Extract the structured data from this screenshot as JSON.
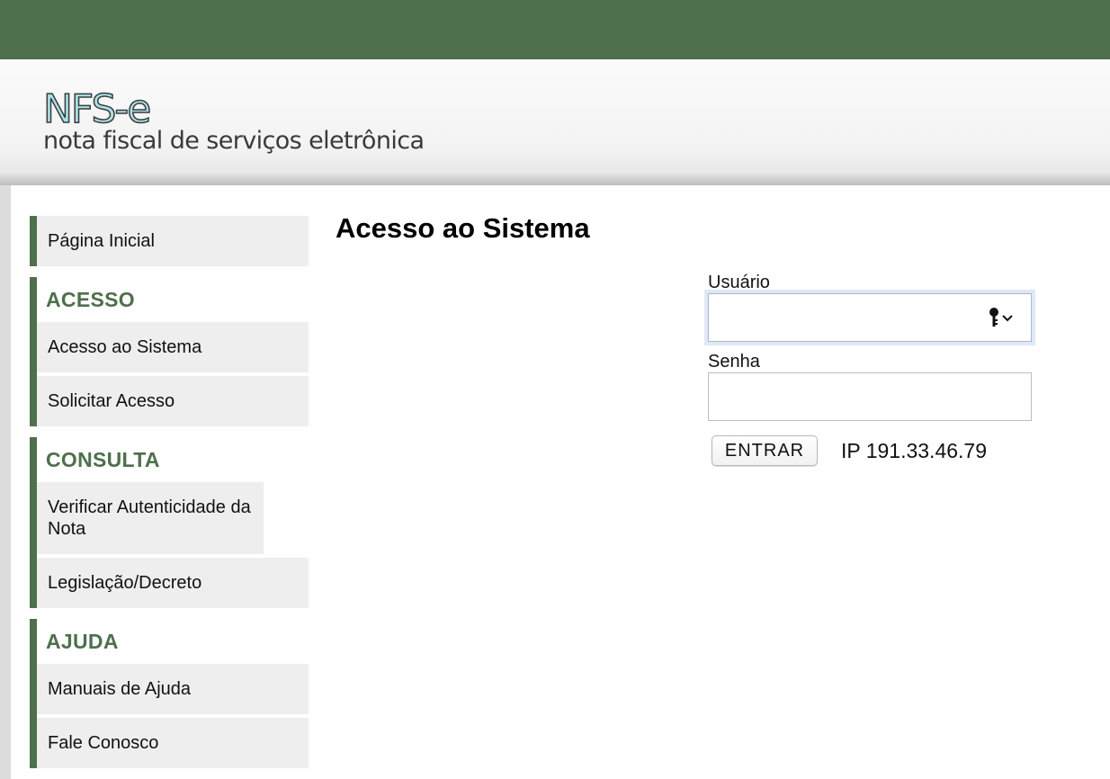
{
  "header": {
    "logo_mark": "NFS-e",
    "logo_subtitle": "nota fiscal de serviços eletrônica"
  },
  "sidebar": {
    "home": "Página Inicial",
    "groups": [
      {
        "heading": "ACESSO",
        "items": [
          "Acesso ao Sistema",
          "Solicitar Acesso"
        ]
      },
      {
        "heading": "CONSULTA",
        "items": [
          "Verificar Autenticidade da Nota",
          "Legislação/Decreto"
        ]
      },
      {
        "heading": "AJUDA",
        "items": [
          "Manuais de Ajuda",
          "Fale Conosco"
        ]
      }
    ]
  },
  "main": {
    "title": "Acesso ao Sistema",
    "form": {
      "user_label": "Usuário",
      "user_value": "",
      "password_label": "Senha",
      "password_value": "",
      "submit_label": "ENTRAR",
      "ip_text": "IP 191.33.46.79"
    }
  },
  "colors": {
    "brand_green": "#4e704c",
    "nav_background": "#eeeeee",
    "logo_fill": "#a7e1e8"
  },
  "icons": {
    "user_field_icon": "key-dropdown-icon"
  }
}
